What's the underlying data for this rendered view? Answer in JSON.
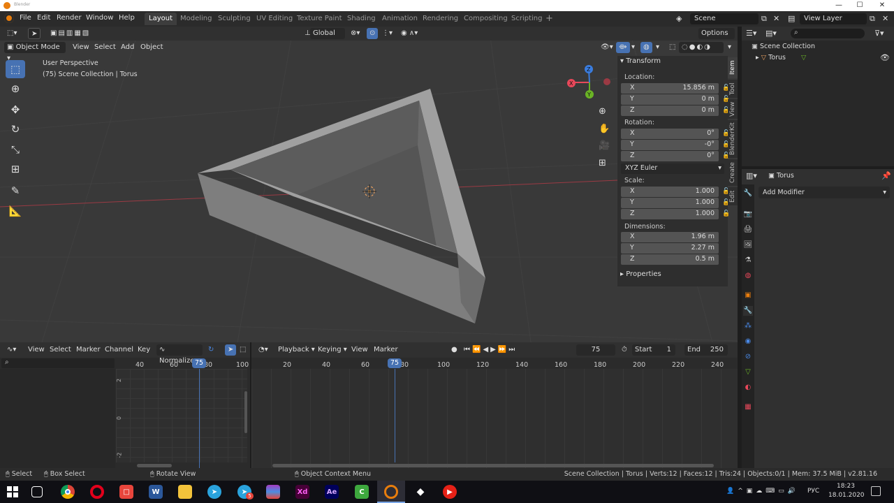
{
  "title_bar": {
    "title": "Blender",
    "minimize": "—",
    "maximize": "☐",
    "close": "✕"
  },
  "top_menu": [
    "File",
    "Edit",
    "Render",
    "Window",
    "Help"
  ],
  "workspaces": [
    "Layout",
    "Modeling",
    "Sculpting",
    "UV Editing",
    "Texture Paint",
    "Shading",
    "Animation",
    "Rendering",
    "Compositing",
    "Scripting"
  ],
  "workspace_add": "+",
  "scene": {
    "name": "Scene",
    "view_layer": "View Layer"
  },
  "viewport_header": {
    "transform_orientation": "Global",
    "options": "Options",
    "mode": "Object Mode",
    "menus": [
      "View",
      "Select",
      "Add",
      "Object"
    ]
  },
  "viewport_overlay": {
    "view_name": "User Perspective",
    "collection_info": "(75) Scene Collection | Torus"
  },
  "gizmo": {
    "x": "X",
    "y": "Y",
    "z": "Z"
  },
  "sidebar_tabs": [
    "Item",
    "Tool",
    "View",
    "BlenderKit",
    "Create",
    "Edit"
  ],
  "transform_panel": {
    "title": "Transform",
    "location_label": "Location:",
    "location": [
      {
        "axis": "X",
        "value": "15.856 m"
      },
      {
        "axis": "Y",
        "value": "0 m"
      },
      {
        "axis": "Z",
        "value": "0 m"
      }
    ],
    "rotation_label": "Rotation:",
    "rotation": [
      {
        "axis": "X",
        "value": "0°"
      },
      {
        "axis": "Y",
        "value": "-0°"
      },
      {
        "axis": "Z",
        "value": "0°"
      }
    ],
    "rotation_mode": "XYZ Euler",
    "scale_label": "Scale:",
    "scale": [
      {
        "axis": "X",
        "value": "1.000"
      },
      {
        "axis": "Y",
        "value": "1.000"
      },
      {
        "axis": "Z",
        "value": "1.000"
      }
    ],
    "dimensions_label": "Dimensions:",
    "dimensions": [
      {
        "axis": "X",
        "value": "1.96 m"
      },
      {
        "axis": "Y",
        "value": "2.27 m"
      },
      {
        "axis": "Z",
        "value": "0.5 m"
      }
    ],
    "properties_title": "Properties"
  },
  "outliner": {
    "root": "Scene Collection",
    "item": "Torus"
  },
  "properties_editor": {
    "object_name": "Torus",
    "add_modifier": "Add Modifier"
  },
  "graph_editor": {
    "menus": [
      "View",
      "Select",
      "Marker",
      "Channel",
      "Key"
    ],
    "normalize": "Normalize",
    "ticks": [
      "40",
      "60",
      "80",
      "100"
    ],
    "current_frame": "75",
    "y_ticks": [
      "2",
      "0",
      "-2"
    ]
  },
  "timeline": {
    "menus": [
      "Playback",
      "Keying",
      "View",
      "Marker"
    ],
    "current_frame": "75",
    "start_label": "Start",
    "start": "1",
    "end_label": "End",
    "end": "250",
    "ticks": [
      "20",
      "40",
      "60",
      "80",
      "100",
      "120",
      "140",
      "160",
      "180",
      "200",
      "220",
      "240"
    ],
    "frame_badge": "75"
  },
  "status_bar": {
    "select": "Select",
    "box_select": "Box Select",
    "rotate_view": "Rotate View",
    "context_menu": "Object Context Menu",
    "stats": "Scene Collection | Torus | Verts:12 | Faces:12 | Tris:24 | Objects:0/1 | Mem: 37.5 MiB | v2.81.16"
  },
  "taskbar": {
    "apps": [
      "chrome",
      "opera",
      "app-red",
      "word",
      "explorer",
      "telegram",
      "telegram-badge",
      "winrar",
      "xd",
      "ae",
      "camtasia",
      "blender",
      "unity",
      "youtube"
    ],
    "app_labels": {
      "word": "W",
      "xd": "Xd",
      "ae": "Ae",
      "camtasia": "C",
      "telegram_badge": "5"
    },
    "language": "РУС",
    "time": "18:23",
    "date": "18.01.2020"
  },
  "colors": {
    "accent": "#4772b3",
    "orange": "#e87d0d",
    "x_axis": "#e8485a",
    "y_axis": "#6ab325",
    "z_axis": "#3a7de0"
  }
}
